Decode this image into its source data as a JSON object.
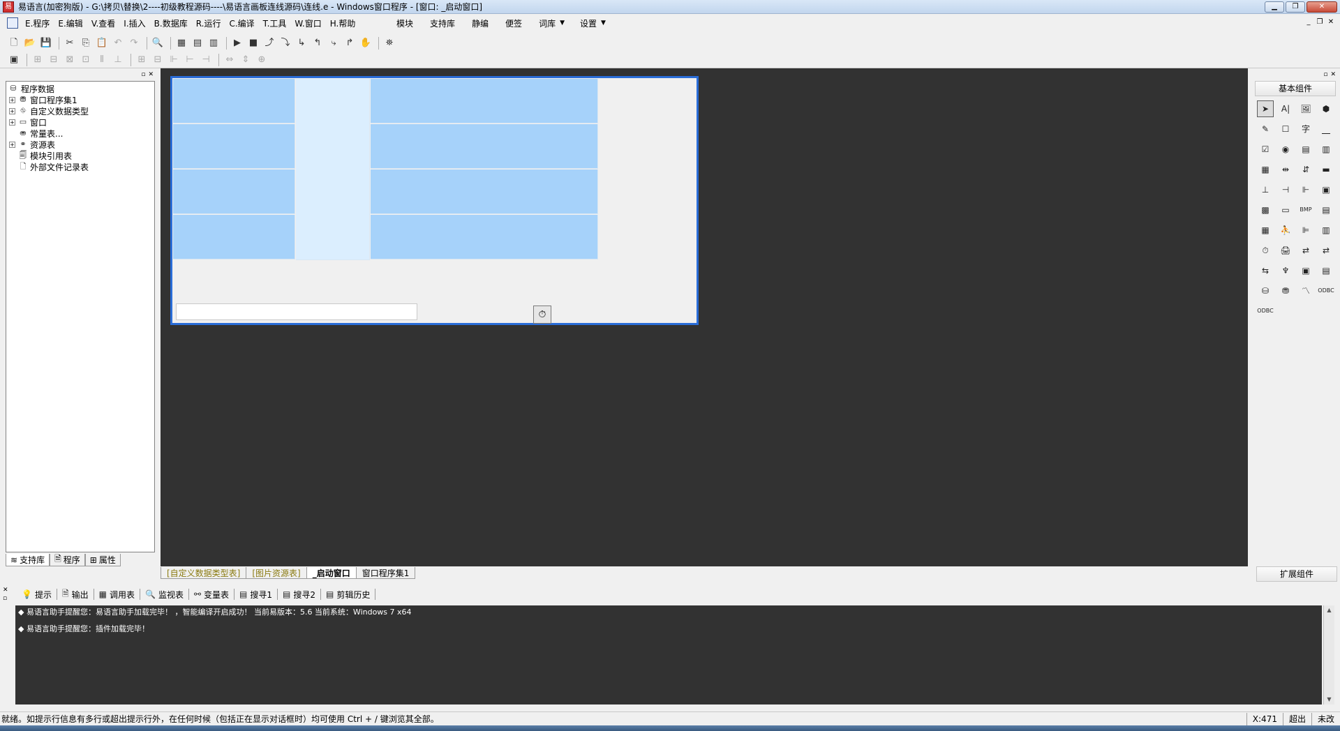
{
  "window": {
    "title": "易语言(加密狗版) - G:\\拷贝\\替换\\2----初级教程源码----\\易语言画板连线源码\\连线.e - Windows窗口程序 - [窗口: _启动窗口]",
    "app_icon": "yi-language-icon",
    "minimize": "▁",
    "maximize": "❐",
    "close": "✕"
  },
  "menubar": {
    "items": [
      "E.程序",
      "E.编辑",
      "V.查看",
      "I.插入",
      "B.数据库",
      "R.运行",
      "C.编译",
      "T.工具",
      "W.窗口",
      "H.帮助"
    ],
    "right_items": [
      "模块",
      "支持库",
      "静编",
      "便签",
      "词库",
      "设置"
    ],
    "caret": "▼",
    "mdi_minimize": "_",
    "mdi_restore": "❐",
    "mdi_close": "✕"
  },
  "toolbar1": {
    "buttons": [
      "🗋",
      "📂",
      "💾",
      "|",
      "✂",
      "⎘",
      "📋",
      "↶",
      "↷",
      "|",
      "🔍",
      "|",
      "▦",
      "▤",
      "▥",
      "|",
      "▶",
      "■",
      "⤴",
      "⤵",
      "↳",
      "↰",
      "⤷",
      "↱",
      "✋",
      "|",
      "⛯"
    ]
  },
  "toolbar2": {
    "buttons": [
      "▣",
      "|",
      "⊞",
      "⊟",
      "⊠",
      "⊡",
      "⫴",
      "⊥",
      "|",
      "⊞",
      "⊟",
      "⊩",
      "⊢",
      "⊣",
      "|",
      "⇔",
      "⇕",
      "⊕"
    ]
  },
  "left_panel": {
    "pin": "▫",
    "close": "✕",
    "tree": [
      {
        "label": "程序数据",
        "level": 0,
        "expander": "",
        "icon": "⛁"
      },
      {
        "label": "窗口程序集1",
        "level": 1,
        "expander": "+",
        "icon": "⛃"
      },
      {
        "label": "自定义数据类型",
        "level": 1,
        "expander": "+",
        "icon": "⛗"
      },
      {
        "label": "窗口",
        "level": 1,
        "expander": "+",
        "icon": "▭"
      },
      {
        "label": "常量表...",
        "level": 1,
        "expander": "",
        "icon": "⛂"
      },
      {
        "label": "资源表",
        "level": 1,
        "expander": "+",
        "icon": "⚭"
      },
      {
        "label": "模块引用表",
        "level": 1,
        "expander": "",
        "icon": "🗐"
      },
      {
        "label": "外部文件记录表",
        "level": 1,
        "expander": "",
        "icon": "🗋"
      }
    ],
    "tabs": [
      {
        "label": "支持库",
        "icon": "≋"
      },
      {
        "label": "程序",
        "icon": "🗎"
      },
      {
        "label": "属性",
        "icon": "⊞"
      }
    ]
  },
  "designer": {
    "tabs": [
      "[自定义数据类型表]",
      "[图片资源表]",
      "_启动窗口",
      "窗口程序集1"
    ],
    "timer_icon": "⏱"
  },
  "right_panel": {
    "pin": "▫",
    "close": "✕",
    "basic_title": "基本组件",
    "ext_title": "扩展组件",
    "components": [
      "➤",
      "A|",
      "🖼",
      "⬢",
      "✎",
      "☐",
      "字",
      "⎽",
      "☑",
      "◉",
      "▤",
      "▥",
      "▦",
      "⇹",
      "⇵",
      "▬",
      "⊥",
      "⊣",
      "⊩",
      "▣",
      "▩",
      "▭",
      "BMP",
      "▤",
      "▦",
      "⛹",
      "⊫",
      "▥",
      "⏱",
      "🖨",
      "⇄",
      "⇄",
      "⇆",
      "♆",
      "▣",
      "▤",
      "⛁",
      "⛃",
      "〽",
      "ODBC",
      "ODBC"
    ]
  },
  "output": {
    "side_pin": "▫",
    "side_close": "✕",
    "tabs": [
      {
        "label": "提示",
        "icon": "💡"
      },
      {
        "label": "输出",
        "icon": "🗎"
      },
      {
        "label": "调用表",
        "icon": "▦"
      },
      {
        "label": "监视表",
        "icon": "🔍"
      },
      {
        "label": "变量表",
        "icon": "⚯"
      },
      {
        "label": "搜寻1",
        "icon": "▤"
      },
      {
        "label": "搜寻2",
        "icon": "▤"
      },
      {
        "label": "剪辑历史",
        "icon": "▤"
      }
    ],
    "lines": [
      "◆ 易语言助手提醒您：易语言助手加载完毕！ ，智能编译开启成功！ 当前易版本：5.6  当前系统：Windows 7 x64",
      "◆ 易语言助手提醒您：插件加载完毕！"
    ],
    "scroll_up": "▲",
    "scroll_down": "▼"
  },
  "statusbar": {
    "message": "就绪。如提示行信息有多行或超出提示行外，在任何时候（包括正在显示对话框时）均可使用 Ctrl + / 键浏览其全部。",
    "coord": "X:471",
    "mode1": "超出",
    "mode2": "未改"
  },
  "colors": {
    "designer_bg": "#323232",
    "form_border": "#2a6dd8",
    "cell_blue": "#a6d2fa",
    "cell_light": "#dbeefe"
  }
}
